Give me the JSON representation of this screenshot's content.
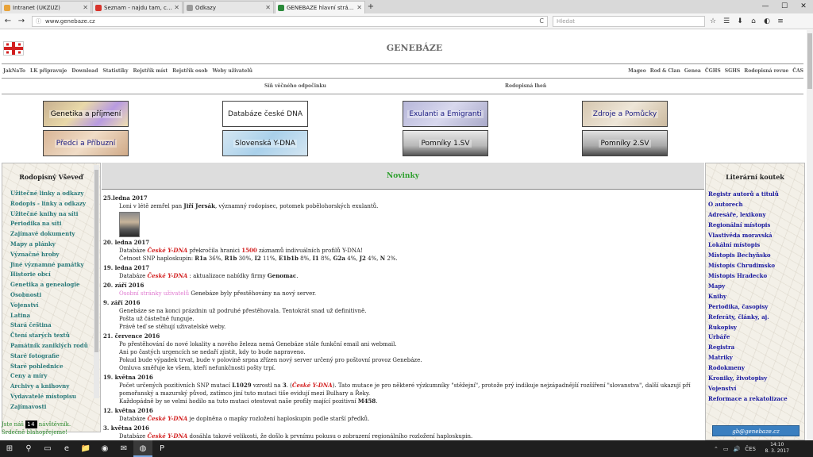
{
  "browser": {
    "tabs": [
      {
        "label": "Intranet (ÚKZÚZ)",
        "color": "#e8a33a"
      },
      {
        "label": "Seznam - najdu tam, co n...",
        "color": "#d8332b"
      },
      {
        "label": "Odkazy",
        "color": "#9a9a9a"
      },
      {
        "label": "GENEBAZE hlavní stránka",
        "color": "#2a8a3a"
      }
    ],
    "new_tab": "+",
    "url": "www.genebaze.cz",
    "search_placeholder": "Hledat",
    "controls": {
      "minimize": "—",
      "maximize": "☐",
      "close": "✕"
    },
    "nav_icons": {
      "back": "←",
      "forward": "→",
      "info": "ⓘ",
      "reload": "C",
      "star": "☆",
      "library": "☰",
      "download": "⬇",
      "home": "⌂",
      "pocket": "◐",
      "menu": "≡"
    }
  },
  "site": {
    "title": "GENEBÁZE",
    "topnav_left": [
      "JakNaTo",
      "LK připravuje",
      "Download",
      "Statistiky",
      "Rejstřík míst",
      "Rejstřík osob",
      "Weby uživatelů"
    ],
    "topnav_right": [
      "Mageo",
      "Rod & Clan",
      "Genea",
      "ČGHS",
      "SGHS",
      "Rodopisná revue",
      "ČAS"
    ],
    "subnav": [
      "Síň věčného odpočinku",
      "Rodopisná lheň"
    ],
    "banners": [
      "Genetika a příjmení",
      "Databáze české DNA",
      "Exulanti a Emigranti",
      "Zdroje a Pomůcky",
      "Předci a Příbuzní",
      "Slovenská Y-DNA",
      "Pomníky 1.SV",
      "Pomníky 2.SV"
    ]
  },
  "left": {
    "heading": "Rodopisný Vševeď",
    "items": [
      "Užitečné linky a odkazy",
      "Rodopis - linky a odkazy",
      "Užitečné knihy na síti",
      "Periodika na síti",
      "Zajímavé dokumenty",
      "Mapy a plánky",
      "Význačné hroby",
      "Jiné významné památky",
      "Historie obcí",
      "Genetika a genealogie",
      "Osobnosti",
      "Vojenství",
      "Latina",
      "Stará čeština",
      "Čtení starých textů",
      "Památník zaniklých rodů",
      "Staré fotografie",
      "Staré pohlednice",
      "Ceny a míry",
      "Archivy a knihovny",
      "Vydavatelé místopisu",
      "Zajímavosti"
    ],
    "visitor_prefix": "Jste náš",
    "visitor_counter": "14",
    "visitor_suffix": "návštěvník.",
    "visitor_line2": "Srdečně blahopřejeme!"
  },
  "center": {
    "heading": "Novinky",
    "entries": [
      {
        "date": "25.ledna 2017",
        "lines": [
          [
            {
              "t": "Loni v létě zemřel pan "
            },
            {
              "t": "Jiří Jersák",
              "s": "b"
            },
            {
              "t": ", významný rodopisec, potomek pobělohorských exulantů."
            }
          ]
        ],
        "photo": true
      },
      {
        "date": "20. ledna 2017",
        "lines": [
          [
            {
              "t": "Databáze "
            },
            {
              "t": "České Y-DNA",
              "s": "red"
            },
            {
              "t": " překročila hranici "
            },
            {
              "t": "1500",
              "s": "rp"
            },
            {
              "t": " záznamů indivuálních profilů Y-DNA!"
            }
          ],
          [
            {
              "t": "Četnost SNP haploskupin: "
            },
            {
              "t": "R1a",
              "s": "b"
            },
            {
              "t": " 36%, "
            },
            {
              "t": "R1b",
              "s": "b"
            },
            {
              "t": " 30%, "
            },
            {
              "t": "I2",
              "s": "b"
            },
            {
              "t": " 11%, "
            },
            {
              "t": "E1b1b",
              "s": "b"
            },
            {
              "t": " 8%, "
            },
            {
              "t": "I1",
              "s": "b"
            },
            {
              "t": " 8%, "
            },
            {
              "t": "G2a",
              "s": "b"
            },
            {
              "t": " 4%, "
            },
            {
              "t": "J2",
              "s": "b"
            },
            {
              "t": " 4%, "
            },
            {
              "t": "N",
              "s": "b"
            },
            {
              "t": " 2%."
            }
          ]
        ]
      },
      {
        "date": "19. ledna 2017",
        "lines": [
          [
            {
              "t": "Databáze "
            },
            {
              "t": "České Y-DNA",
              "s": "red"
            },
            {
              "t": " : aktualizace nabídky firmy "
            },
            {
              "t": "Genomac",
              "s": "b"
            },
            {
              "t": "."
            }
          ]
        ]
      },
      {
        "date": "20. září 2016",
        "lines": [
          [
            {
              "t": "Osobní stránky uživatelů",
              "s": "pink"
            },
            {
              "t": " Genebáze byly přestěhovány na nový server."
            }
          ]
        ]
      },
      {
        "date": "9. září 2016",
        "lines": [
          [
            {
              "t": "Genebáze se na konci prázdnin už podruhé přestěhovala. Tentokrát snad už definitivně."
            }
          ],
          [
            {
              "t": "Pošta už částečně funguje."
            }
          ],
          [
            {
              "t": "Právě teď se stěhují uživatelské weby."
            }
          ]
        ]
      },
      {
        "date": "21. července 2016",
        "lines": [
          [
            {
              "t": "Po přestěhování do nové lokality a nového železa nemá Genebáze stále funkční email ani webmail."
            }
          ],
          [
            {
              "t": "Ani po častých urgencích se nedaří zjistit, kdy to bude napraveno."
            }
          ],
          [
            {
              "t": "Pokud bude výpadek trvat, bude v polovině srpna zřízen nový server určený pro poštovní provoz Genebáze."
            }
          ],
          [
            {
              "t": "Omluva směřuje ke všem, kteří nefunkčnosti pošty trpí."
            }
          ]
        ]
      },
      {
        "date": "19. května 2016",
        "lines": [
          [
            {
              "t": "Počet určených pozitivních SNP mutací "
            },
            {
              "t": "L1029",
              "s": "b"
            },
            {
              "t": " vzrostl na "
            },
            {
              "t": "3",
              "s": "b"
            },
            {
              "t": ". ("
            },
            {
              "t": "České Y-DNA",
              "s": "red"
            },
            {
              "t": "). Tato mutace je pro některé výzkumníky \"stěžejní\", protože prý indikuje nejzápadnější rozšíření \"slovanstva\", další ukazují přímo na"
            }
          ],
          [
            {
              "t": "pomořanský a mazurský původ, zatímco jiní tuto mutaci tiše evidují mezi Bulhary a Řeky."
            }
          ],
          [
            {
              "t": "Každopádně by se velmi hodilo na tuto mutaci otestovat naše profily mající pozitivní "
            },
            {
              "t": "M458",
              "s": "b"
            },
            {
              "t": "."
            }
          ]
        ]
      },
      {
        "date": "12. května 2016",
        "lines": [
          [
            {
              "t": "Databáze "
            },
            {
              "t": "České Y-DNA",
              "s": "red"
            },
            {
              "t": " je doplněna o mapky rozložení haploskupin podle starší předků."
            }
          ]
        ]
      },
      {
        "date": "3. května 2016",
        "lines": [
          [
            {
              "t": "Databáze "
            },
            {
              "t": "České Y-DNA",
              "s": "red"
            },
            {
              "t": " dosáhla takové velikosti, že došlo k prvnímu pokusu o zobrazení regionálního rozložení haploskupin."
            }
          ]
        ]
      }
    ]
  },
  "right": {
    "heading": "Literární koutek",
    "items": [
      "Registr autorů a titulů",
      "O autorech",
      "Adresáře, lexikony",
      "Regionální místopis",
      "Vlastivěda moravská",
      "Lokální místopis",
      "Místopis Bechyňsko",
      "Místopis Chrudimsko",
      "Místopis Hradecko",
      "Mapy",
      "Knihy",
      "Periodika, časopisy",
      "Referáty, články, aj.",
      "Rukopisy",
      "Urbáře",
      "Registra",
      "Matriky",
      "Rodokmeny",
      "Kroniky, životopisy",
      "Vojenství",
      "Reformace a rekatolizace"
    ],
    "email": "gb@genebaze.cz"
  },
  "taskbar": {
    "icons": [
      "windows-icon",
      "search-icon",
      "task-view-icon",
      "edge-icon",
      "explorer-icon",
      "chrome-icon",
      "outlook-icon",
      "firefox-icon",
      "powerpoint-icon"
    ],
    "glyphs": [
      "⊞",
      "⚲",
      "▭",
      "e",
      "📁",
      "◉",
      "✉",
      "◍",
      "P"
    ],
    "time": "14:10",
    "date": "8. 3. 2017",
    "tray": [
      "⌃",
      "▭",
      "🔊",
      "ČES"
    ]
  }
}
